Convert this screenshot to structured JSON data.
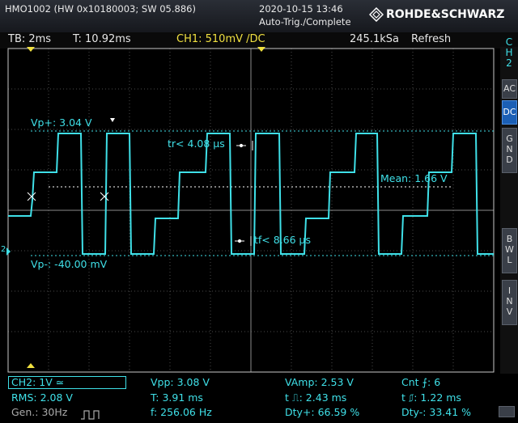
{
  "header": {
    "device": "HMO1002 (HW 0x10180003; SW 05.886)",
    "datetime": "2020-10-15 13:46",
    "status": "Auto-Trig./Complete",
    "brand": "ROHDE&SCHWARZ"
  },
  "info": {
    "timebase": "TB: 2ms",
    "trigger_time": "T: 10.92ms",
    "channel": "CH1: 510mV /DC",
    "sample_rate": "245.1kSa",
    "mode": "Refresh"
  },
  "side": {
    "ch_label": [
      "C",
      "H",
      "2"
    ],
    "buttons": [
      {
        "label": "AC",
        "active": false
      },
      {
        "label": "DC",
        "active": true
      },
      {
        "label": "G\nN\nD",
        "active": false
      },
      {
        "label": "B\nW\nL",
        "active": false
      },
      {
        "label": "I\nN\nV",
        "active": false
      }
    ]
  },
  "annotations": {
    "vp_plus": "Vp+: 3.04 V",
    "vp_minus": "Vp-: -40.00 mV",
    "tr": "tr< 4.08 µs",
    "tf": "tf< 8.66 µs",
    "mean": "Mean: 1.66 V",
    "ch_marker": "2"
  },
  "footer": {
    "ch_setting": "CH2: 1V ≃",
    "rms": "RMS: 2.08 V",
    "gen": "Gen.:  30Hz",
    "vpp": "Vpp: 3.08 V",
    "period": "T: 3.91 ms",
    "freq": "f: 256.06 Hz",
    "vamp": "VAmp: 2.53 V",
    "t_pos": "t ⎍: 2.43 ms",
    "dty_pos": "Dty+: 66.59 %",
    "cnt": "Cnt ⨍: 6",
    "t_neg": "t ⎎: 1.22 ms",
    "dty_neg": "Dty-: 33.41 %"
  },
  "colors": {
    "trace": "#3fe0e8",
    "grid": "#505050",
    "accent": "#f0e040"
  }
}
